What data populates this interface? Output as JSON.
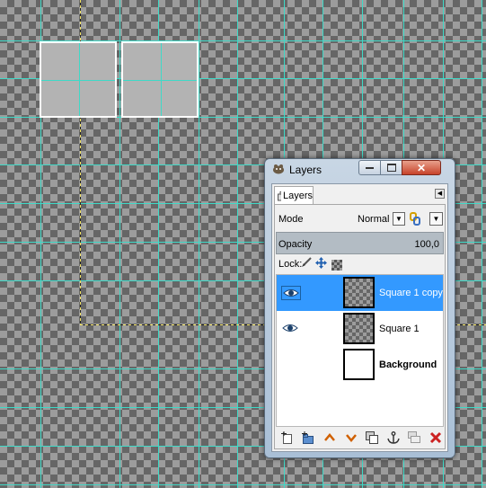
{
  "dialog": {
    "title": "Layers",
    "close_glyph": "✕",
    "tab_label": "Layers",
    "mode_label": "Mode",
    "mode_value": "Normal",
    "opacity_label": "Opacity",
    "opacity_value": "100,0",
    "lock_label": "Lock:"
  },
  "layers": [
    {
      "name": "Square 1 copy",
      "visible": true,
      "selected": true,
      "thumbnail": "checker"
    },
    {
      "name": "Square 1",
      "visible": true,
      "selected": false,
      "thumbnail": "checker"
    },
    {
      "name": "Background",
      "visible": false,
      "selected": false,
      "thumbnail": "white"
    }
  ],
  "toolbar_icons": [
    "new-layer-icon",
    "new-layer-group-icon",
    "raise-layer-icon",
    "lower-layer-icon",
    "duplicate-layer-icon",
    "anchor-layer-icon",
    "merge-layer-icon",
    "delete-layer-icon"
  ],
  "colors": {
    "guide": "#3fd9c7",
    "selection_highlight": "#3399ff",
    "delete_icon": "#cc2222",
    "raise_lower_icon": "#d06000"
  }
}
